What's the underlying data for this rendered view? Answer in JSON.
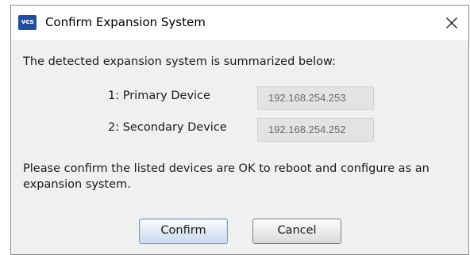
{
  "window": {
    "title": "Confirm Expansion System",
    "app_icon_text": "vcs",
    "accent_color": "#1e4fa3"
  },
  "dialog": {
    "summary_text": "The detected expansion system is summarized below:",
    "devices": [
      {
        "label": "1: Primary Device",
        "ip": "192.168.254.253"
      },
      {
        "label": "2: Secondary Device",
        "ip": "192.168.254.252"
      }
    ],
    "confirm_message": "Please confirm the listed devices are OK to reboot and configure as an expansion system."
  },
  "buttons": {
    "confirm_label": "Confirm",
    "cancel_label": "Cancel"
  },
  "icons": {
    "close": "close-icon",
    "app": "app-logo-icon"
  }
}
